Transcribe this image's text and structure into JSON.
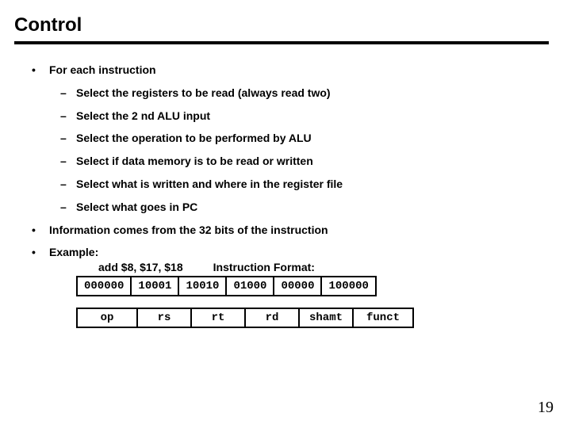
{
  "title": "Control",
  "bullet1": "For each instruction",
  "sub": {
    "a": "Select the registers to be read (always read two)",
    "b": "Select the 2 nd ALU input",
    "c": "Select the operation to be performed by ALU",
    "d": "Select if data memory is to be read or written",
    "e": "Select what is written and where in the register file",
    "f": "Select what goes in PC"
  },
  "bullet2": "Information comes from the 32 bits of the instruction",
  "bullet3": "Example:",
  "example_left": "add $8, $17, $18",
  "example_right": "Instruction Format:",
  "fields": {
    "v0": "000000",
    "v1": "10001",
    "v2": "10010",
    "v3": "01000",
    "v4": "00000",
    "v5": "100000",
    "n0": "op",
    "n1": "rs",
    "n2": "rt",
    "n3": "rd",
    "n4": "shamt",
    "n5": "funct"
  },
  "page": "19"
}
